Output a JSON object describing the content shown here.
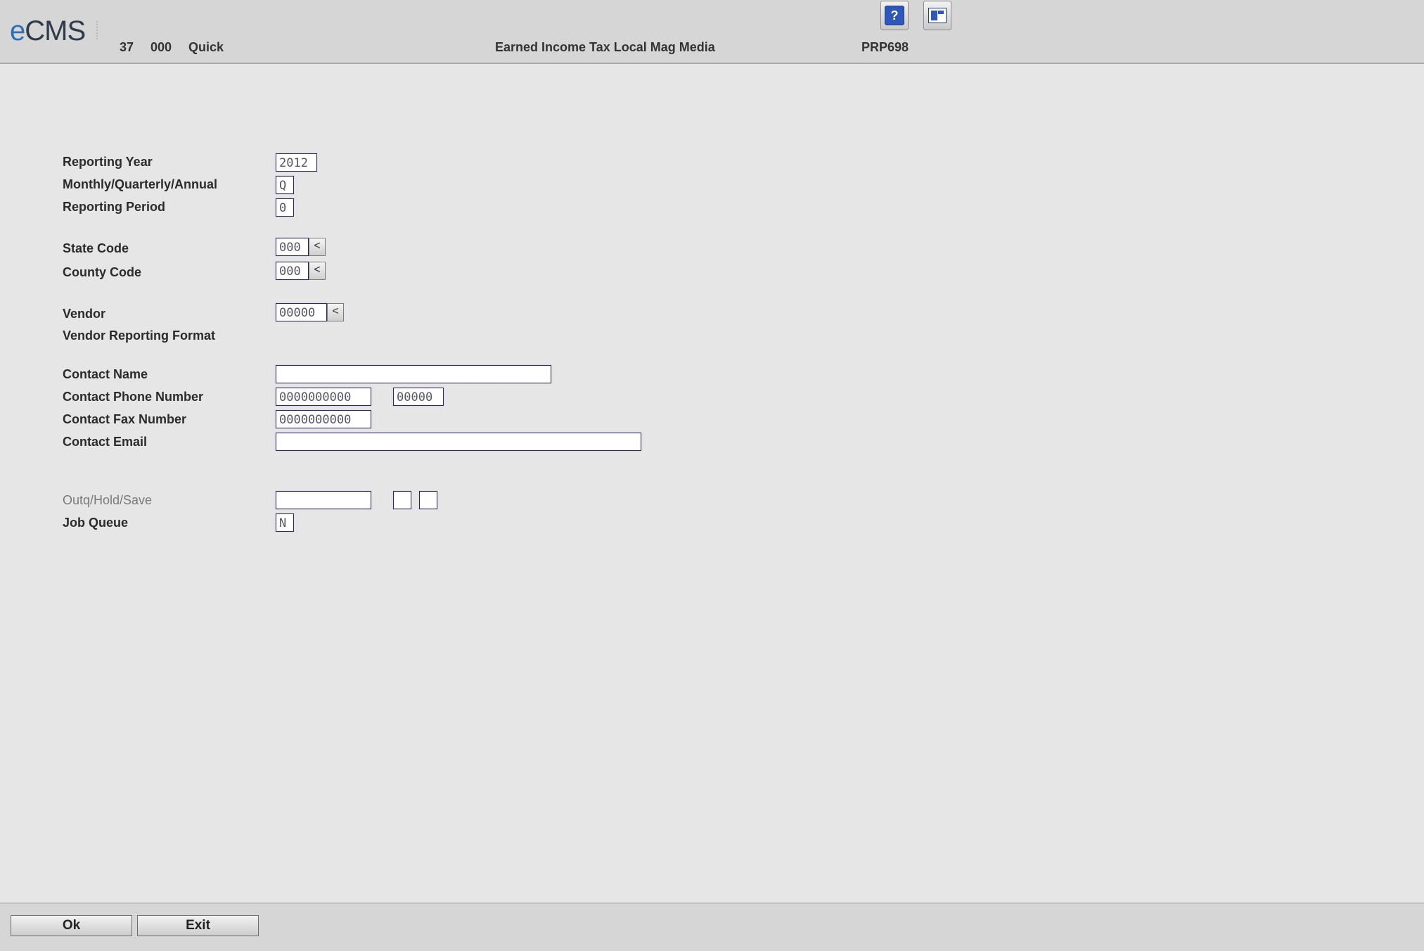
{
  "header": {
    "logo_prefix": "e",
    "logo_suffix": "CMS",
    "company": "37",
    "division": "000",
    "mode": "Quick",
    "title": "Earned Income Tax Local Mag Media",
    "program_id": "PRP698",
    "help_icon_glyph": "?",
    "help_icon": "help-icon",
    "window_icon": "window-icon"
  },
  "form": {
    "reporting_year": {
      "label": "Reporting Year",
      "value": "2012"
    },
    "frequency": {
      "label": "Monthly/Quarterly/Annual",
      "value": "Q"
    },
    "reporting_period": {
      "label": "Reporting Period",
      "value": "0"
    },
    "state_code": {
      "label": "State Code",
      "value": "000"
    },
    "county_code": {
      "label": "County Code",
      "value": "000"
    },
    "vendor": {
      "label": "Vendor",
      "value": "00000"
    },
    "vendor_format": {
      "label": "Vendor Reporting Format"
    },
    "contact_name": {
      "label": "Contact Name",
      "value": ""
    },
    "contact_phone": {
      "label": "Contact Phone Number",
      "value": "0000000000",
      "ext": "00000"
    },
    "contact_fax": {
      "label": "Contact Fax Number",
      "value": "0000000000"
    },
    "contact_email": {
      "label": "Contact Email",
      "value": ""
    },
    "outq": {
      "label": "Outq/Hold/Save",
      "value": "",
      "hold": "",
      "save": ""
    },
    "job_queue": {
      "label": "Job Queue",
      "value": "N"
    },
    "lookup_glyph": "<"
  },
  "footer": {
    "ok_label": "Ok",
    "exit_label": "Exit"
  }
}
